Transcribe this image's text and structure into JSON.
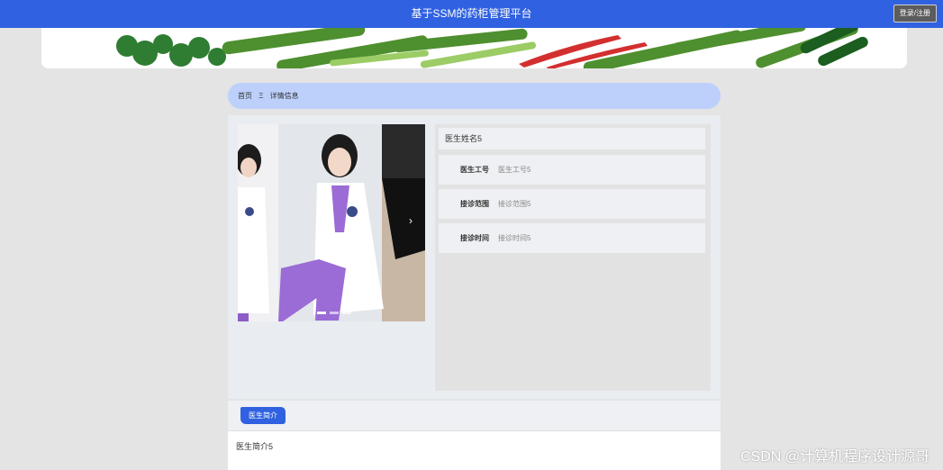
{
  "header": {
    "title": "基于SSM的药柜管理平台",
    "login_label": "登录/注册",
    "bg_color": "#2f61e0"
  },
  "banner": {
    "image": "vegetables-banner"
  },
  "breadcrumb": {
    "home": "首页",
    "separator": "Ξ",
    "current": "详情信息"
  },
  "gallery": {
    "image": "doctor-photo",
    "next_icon": "›",
    "slide_count": 3,
    "active_slide": 0
  },
  "info": {
    "name": "医生姓名5",
    "rows": [
      {
        "label": "医生工号",
        "value": "医生工号5"
      },
      {
        "label": "接诊范围",
        "value": "接诊范围5"
      },
      {
        "label": "接诊时间",
        "value": "接诊时间5"
      }
    ]
  },
  "intro": {
    "tab_label": "医生简介",
    "content": "医生简介5"
  },
  "watermark": "CSDN @计算机程序设计源哥"
}
